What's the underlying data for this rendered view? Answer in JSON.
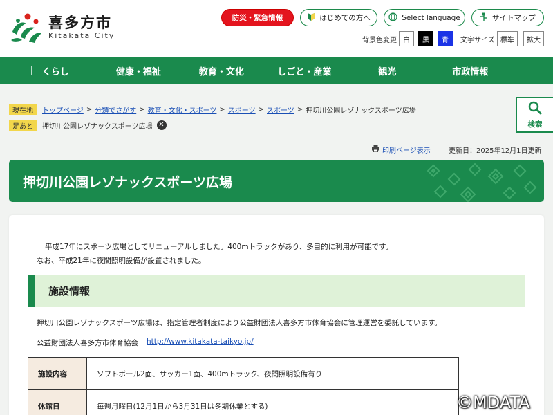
{
  "header": {
    "logo_jp": "喜多方市",
    "logo_en": "Kitakata City",
    "disaster_button": "防災・緊急情報",
    "first_visit_button": "はじめての方へ",
    "language_button": "Select language",
    "sitemap_button": "サイトマップ",
    "bg_color_label": "背景色変更",
    "bg_white": "白",
    "bg_black": "黒",
    "bg_blue": "青",
    "font_size_label": "文字サイズ",
    "font_standard": "標準",
    "font_large": "拡大"
  },
  "nav": {
    "items": [
      {
        "label": "くらし"
      },
      {
        "label": "健康・福祉"
      },
      {
        "label": "教育・文化"
      },
      {
        "label": "しごと・産業"
      },
      {
        "label": "観光"
      },
      {
        "label": "市政情報"
      }
    ]
  },
  "breadcrumb": {
    "current_tag": "現在地",
    "links": [
      "トップページ",
      "分類でさがす",
      "教育・文化・スポーツ",
      "スポーツ",
      "スポーツ"
    ],
    "current": "押切川公園レゾナックスポーツ広場",
    "history_tag": "足あと",
    "history_item": "押切川公園レゾナックスポーツ広場"
  },
  "search": {
    "label": "検索"
  },
  "page": {
    "print_link": "印刷ページ表示",
    "updated": "更新日：2025年12月1日更新",
    "title": "押切川公園レゾナックスポーツ広場",
    "intro_1": "平成17年にスポーツ広場としてリニューアルしました。400mトラックがあり、多目的に利用が可能です。",
    "intro_2": "なお、平成21年に夜間照明設備が設置されました。",
    "section_title": "施設情報",
    "management_text": "押切川公園レゾナックスポーツ広場は、指定管理者制度により公益財団法人喜多方市体育協会に管理運営を委託しています。",
    "org_name": "公益財団法人喜多方市体育協会",
    "org_url": "http://www.kitakata-taikyo.jp/"
  },
  "table": {
    "rows": [
      {
        "label": "施設内容",
        "value": "ソフトボール2面、サッカー1面、400mトラック、夜間照明設備有り"
      },
      {
        "label": "休館日",
        "value": "毎週月曜日(12月1日から3月31日は冬期休業とする)"
      }
    ]
  },
  "watermark": "©MDATA",
  "colors": {
    "brand_green": "#1a8a4d",
    "alert_red": "#e4141e",
    "link_blue": "#1a4fb5",
    "tag_yellow": "#f2d64b"
  }
}
